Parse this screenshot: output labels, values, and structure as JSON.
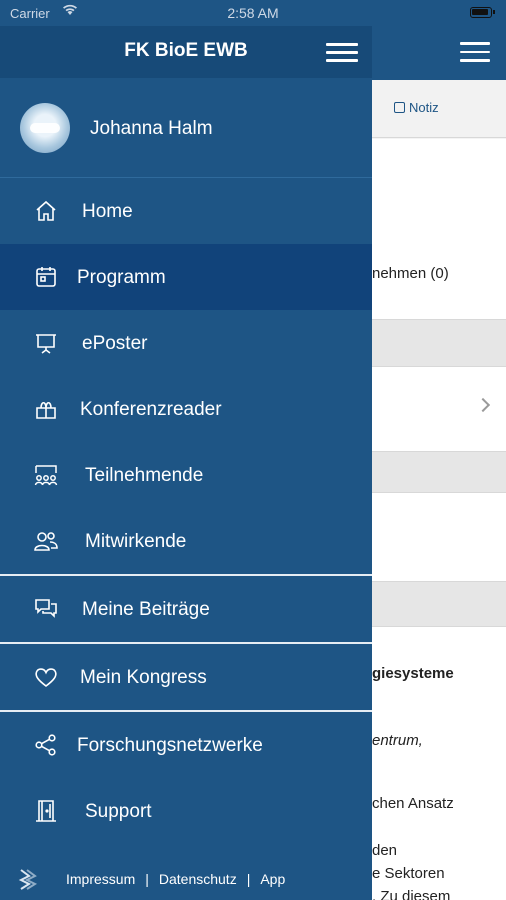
{
  "status_bar": {
    "carrier": "Carrier",
    "time": "2:58 AM"
  },
  "background": {
    "note_label": "Notiz",
    "text_lines": [
      "nehmen (0)",
      "giesysteme",
      "entrum,",
      "chen Ansatz",
      "den",
      "e Sektoren",
      ". Zu diesem"
    ]
  },
  "drawer": {
    "title": "FK BioE EWB",
    "profile_name": "Johanna Halm",
    "items": [
      {
        "label": "Home",
        "icon": "home-icon"
      },
      {
        "label": "Programm",
        "icon": "calendar-icon",
        "active": true
      },
      {
        "label": "ePoster",
        "icon": "presentation-icon"
      },
      {
        "label": "Konferenzreader",
        "icon": "book-icon"
      },
      {
        "label": "Teilnehmende",
        "icon": "audience-icon"
      },
      {
        "label": "Mitwirkende",
        "icon": "people-icon"
      },
      {
        "label": "Meine Beiträge",
        "icon": "chat-bubbles-icon"
      },
      {
        "label": "Mein Kongress",
        "icon": "heart-icon"
      },
      {
        "label": "Forschungsnetzwerke",
        "icon": "share-icon"
      },
      {
        "label": "Support",
        "icon": "door-icon"
      }
    ],
    "footer": {
      "links": [
        "Impressum",
        "Datenschutz",
        "App"
      ],
      "separator": "|"
    }
  },
  "colors": {
    "drawer_bg": "#1e5585",
    "active_bg": "#11437a",
    "header_bg": "#174a78"
  }
}
